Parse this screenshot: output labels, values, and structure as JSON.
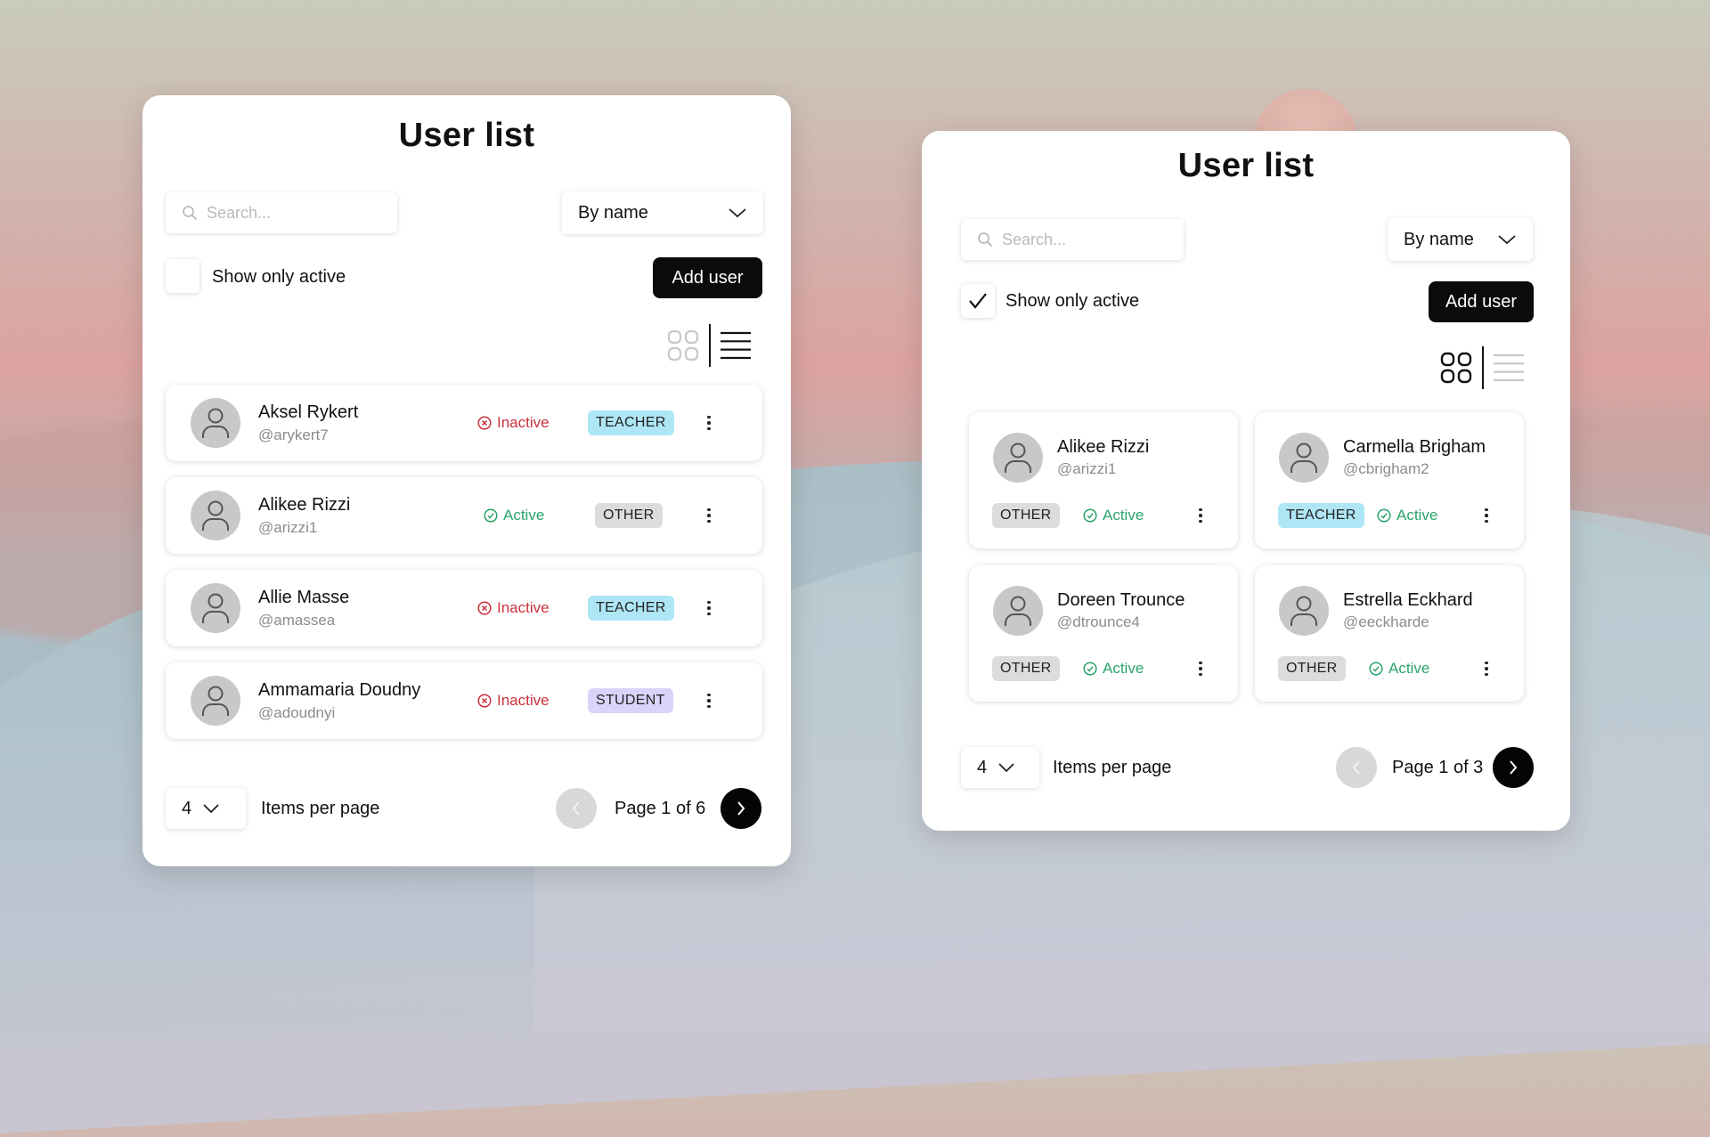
{
  "colors": {
    "accent": "#0b0b0b",
    "active": "#2aa46a",
    "inactive": "#c9303b",
    "teacher_badge": "#aee6f5",
    "other_badge": "#dcdcdc",
    "student_badge": "#dcd3fb"
  },
  "left_panel": {
    "title": "User list",
    "search_placeholder": "Search...",
    "sort_value": "By name",
    "show_only_active_label": "Show only active",
    "show_only_active_checked": false,
    "add_user_label": "Add user",
    "view_mode": "list",
    "users": [
      {
        "name": "Aksel Rykert",
        "handle": "@arykert7",
        "status": "Inactive",
        "role": "TEACHER"
      },
      {
        "name": "Alikee Rizzi",
        "handle": "@arizzi1",
        "status": "Active",
        "role": "OTHER"
      },
      {
        "name": "Allie Masse",
        "handle": "@amassea",
        "status": "Inactive",
        "role": "TEACHER"
      },
      {
        "name": "Ammamaria Doudny",
        "handle": "@adoudnyi",
        "status": "Inactive",
        "role": "STUDENT"
      }
    ],
    "items_per_page": "4",
    "items_per_page_label": "Items per page",
    "page_label": "Page 1 of 6"
  },
  "right_panel": {
    "title": "User list",
    "search_placeholder": "Search...",
    "sort_value": "By name",
    "show_only_active_label": "Show only active",
    "show_only_active_checked": true,
    "add_user_label": "Add user",
    "view_mode": "grid",
    "users": [
      {
        "name": "Alikee Rizzi",
        "handle": "@arizzi1",
        "status": "Active",
        "role": "OTHER"
      },
      {
        "name": "Carmella Brigham",
        "handle": "@cbrigham2",
        "status": "Active",
        "role": "TEACHER"
      },
      {
        "name": "Doreen Trounce",
        "handle": "@dtrounce4",
        "status": "Active",
        "role": "OTHER"
      },
      {
        "name": "Estrella Eckhard",
        "handle": "@eeckharde",
        "status": "Active",
        "role": "OTHER"
      }
    ],
    "items_per_page": "4",
    "items_per_page_label": "Items per page",
    "page_label": "Page 1 of 3"
  }
}
